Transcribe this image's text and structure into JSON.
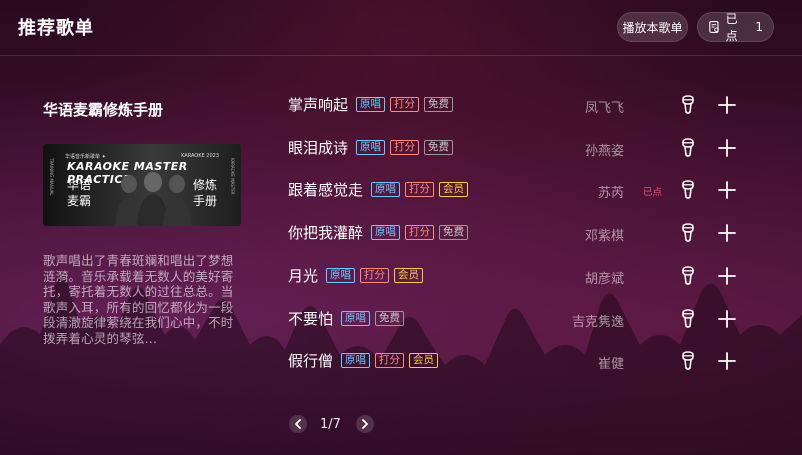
{
  "header": {
    "title": "推荐歌单",
    "play_all_label": "播放本歌单",
    "queue_label": "已点",
    "queue_count": "1"
  },
  "playlist": {
    "title": "华语麦霸修炼手册",
    "description": "歌声唱出了青春斑斓和唱出了梦想涟漪。音乐承载着无数人的美好寄托，寄托着无数人的过往总总。当歌声入耳，所有的回忆都化为一段段清澈旋律萦绕在我们心中，不时拨弄着心灵的琴弦...",
    "cover": {
      "subtitle_left": "华语音乐新歌单 ✦",
      "subtitle_right": "KARAOKE 2023",
      "headline": "KARAOKE MASTER PRACTICE",
      "cn_left_1": "华语",
      "cn_left_2": "麦霸",
      "cn_right_1": "修炼",
      "cn_right_2": "手册",
      "side_left": "TRAINING MANUAL",
      "side_right": "KARAOKE MASTER"
    }
  },
  "songs": [
    {
      "title": "掌声响起",
      "tags": [
        {
          "label": "原唱",
          "kind": "orig"
        },
        {
          "label": "打分",
          "kind": "score"
        },
        {
          "label": "免费",
          "kind": "free"
        }
      ],
      "artist": "凤飞飞",
      "queued_label": ""
    },
    {
      "title": "眼泪成诗",
      "tags": [
        {
          "label": "原唱",
          "kind": "orig"
        },
        {
          "label": "打分",
          "kind": "score"
        },
        {
          "label": "免费",
          "kind": "free"
        }
      ],
      "artist": "孙燕姿",
      "queued_label": ""
    },
    {
      "title": "跟着感觉走",
      "tags": [
        {
          "label": "原唱",
          "kind": "orig"
        },
        {
          "label": "打分",
          "kind": "score"
        },
        {
          "label": "会员",
          "kind": "vip"
        }
      ],
      "artist": "苏芮",
      "queued_label": "已点"
    },
    {
      "title": "你把我灌醉",
      "tags": [
        {
          "label": "原唱",
          "kind": "orig"
        },
        {
          "label": "打分",
          "kind": "score"
        },
        {
          "label": "免费",
          "kind": "free"
        }
      ],
      "artist": "邓紫棋",
      "queued_label": ""
    },
    {
      "title": "月光",
      "tags": [
        {
          "label": "原唱",
          "kind": "orig"
        },
        {
          "label": "打分",
          "kind": "score"
        },
        {
          "label": "会员",
          "kind": "vip"
        }
      ],
      "artist": "胡彦斌",
      "queued_label": ""
    },
    {
      "title": "不要怕",
      "tags": [
        {
          "label": "原唱",
          "kind": "orig"
        },
        {
          "label": "免费",
          "kind": "free"
        }
      ],
      "artist": "吉克隽逸",
      "queued_label": ""
    },
    {
      "title": "假行僧",
      "tags": [
        {
          "label": "原唱",
          "kind": "orig"
        },
        {
          "label": "打分",
          "kind": "score"
        },
        {
          "label": "会员",
          "kind": "vip"
        }
      ],
      "artist": "崔健",
      "queued_label": ""
    }
  ],
  "pagination": {
    "text": "1/7"
  },
  "colors": {
    "tag_orig": "#6ec6ff",
    "tag_score": "#ff8a7a",
    "tag_free": "#c9c9c9",
    "tag_vip": "#f7c948",
    "queued": "#ff4d6a"
  },
  "icons": {
    "queue": "playlist-doc-icon",
    "mic": "microphone-icon",
    "add": "plus-icon",
    "prev": "chevron-left-icon",
    "next": "chevron-right-icon"
  }
}
